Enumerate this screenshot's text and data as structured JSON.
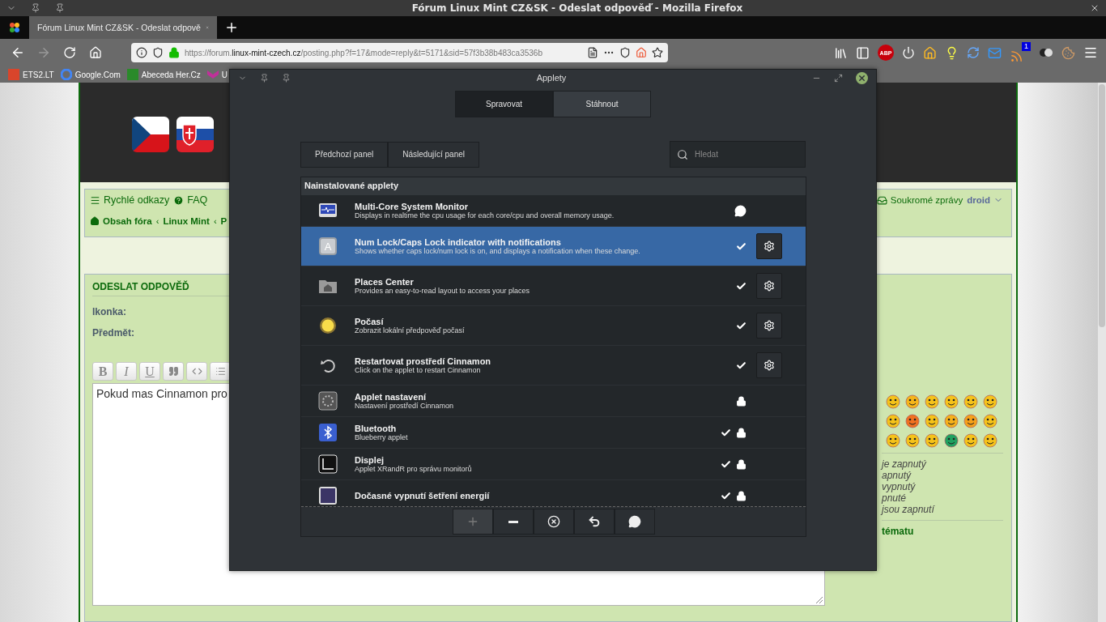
{
  "os_titlebar": {
    "title": "Fórum Linux Mint CZ&SK - Odeslat odpověď - Mozilla Firefox"
  },
  "browser": {
    "tabs": [
      {
        "title": "Fórum Linux Mint CZ&SK - Odeslat odpově",
        "selected": true
      }
    ],
    "url": {
      "prefix": "https://forum.",
      "domain": "linux-mint-czech.cz",
      "path": "/posting.php?f=17&mode=reply&t=5171&sid=57f3b38b483ca3536b"
    },
    "abp_label": "ABP",
    "notification_badge": "1",
    "bookmarks": [
      {
        "title": "ETS2.LT"
      },
      {
        "title": "Google.Com"
      },
      {
        "title": "Abeceda Her.Cz"
      },
      {
        "title": "U"
      }
    ]
  },
  "forum": {
    "quick_links": "Rychlé odkazy",
    "faq": "FAQ",
    "breadcrumbs": [
      {
        "label": "Obsah fóra"
      },
      {
        "separator": "‹",
        "label": "Linux Mint"
      },
      {
        "separator": "‹",
        "label": "P"
      }
    ],
    "private_messages": "Soukromé zprávy",
    "user": "droid",
    "post": {
      "heading": "ODESLAT ODPOVĚĎ",
      "fields": [
        {
          "label": "Ikonka:"
        },
        {
          "label": "Předmět:"
        }
      ],
      "editor_buttons": [
        {
          "kind": "bold",
          "label": "B"
        },
        {
          "kind": "italic",
          "label": "I"
        },
        {
          "kind": "underline",
          "label": "U"
        },
        {
          "kind": "quote"
        },
        {
          "kind": "code"
        },
        {
          "kind": "list"
        }
      ],
      "message": "Pokud mas Cinnamon pro",
      "bbcode_status": [
        "je zapnutý",
        "apnutý",
        "vypnutý",
        "pnuté",
        "jsou zapnutí"
      ],
      "topic_link": "tématu"
    }
  },
  "dialog": {
    "title": "Applety",
    "tabs": [
      {
        "label": "Spravovat",
        "selected": true
      },
      {
        "label": "Stáhnout",
        "selected": false
      }
    ],
    "panel_buttons": [
      "Předchozí panel",
      "Následující panel"
    ],
    "search": {
      "placeholder": "Hledat"
    },
    "list_heading": "Nainstalované applety",
    "applets": [
      {
        "title": "Multi-Core System Monitor",
        "description": "Displays in realtime the cpu usage for each core/cpu and overall memory usage.",
        "selected": false,
        "enabled": false,
        "configurable": false,
        "locked": false,
        "error": true
      },
      {
        "title": "Num Lock/Caps Lock indicator with notifications",
        "description": "Shows whether caps lock/num lock is on, and displays a notification when these change.",
        "selected": true,
        "enabled": true,
        "configurable": true,
        "locked": false,
        "error": false,
        "icon_text": "A"
      },
      {
        "title": "Places Center",
        "description": "Provides an easy-to-read layout to access your places",
        "selected": false,
        "enabled": true,
        "configurable": true,
        "locked": false,
        "error": false
      },
      {
        "title": "Počasí",
        "description": "Zobrazit lokální předpověď počasí",
        "selected": false,
        "enabled": true,
        "configurable": true,
        "locked": false,
        "error": false
      },
      {
        "title": "Restartovat prostředí Cinnamon",
        "description": "Click on the applet to restart Cinnamon",
        "selected": false,
        "enabled": true,
        "configurable": true,
        "locked": false,
        "error": false
      },
      {
        "title": "Applet nastavení",
        "description": "Nastavení prostředí Cinnamon",
        "selected": false,
        "enabled": false,
        "configurable": false,
        "locked": true,
        "error": false
      },
      {
        "title": "Bluetooth",
        "description": "Blueberry applet",
        "selected": false,
        "enabled": true,
        "configurable": false,
        "locked": true,
        "error": false
      },
      {
        "title": "Displej",
        "description": "Applet XRandR pro správu monitorů",
        "selected": false,
        "enabled": true,
        "configurable": false,
        "locked": true,
        "error": false
      },
      {
        "title": "Dočasné vypnutí šetření energií",
        "selected": false,
        "enabled": true,
        "configurable": false,
        "locked": true,
        "error": false
      }
    ],
    "actions": [
      {
        "kind": "add",
        "disabled": true
      },
      {
        "kind": "remove",
        "disabled": false
      },
      {
        "kind": "clear",
        "disabled": false
      },
      {
        "kind": "restore",
        "disabled": false
      },
      {
        "kind": "about",
        "disabled": false
      }
    ]
  }
}
